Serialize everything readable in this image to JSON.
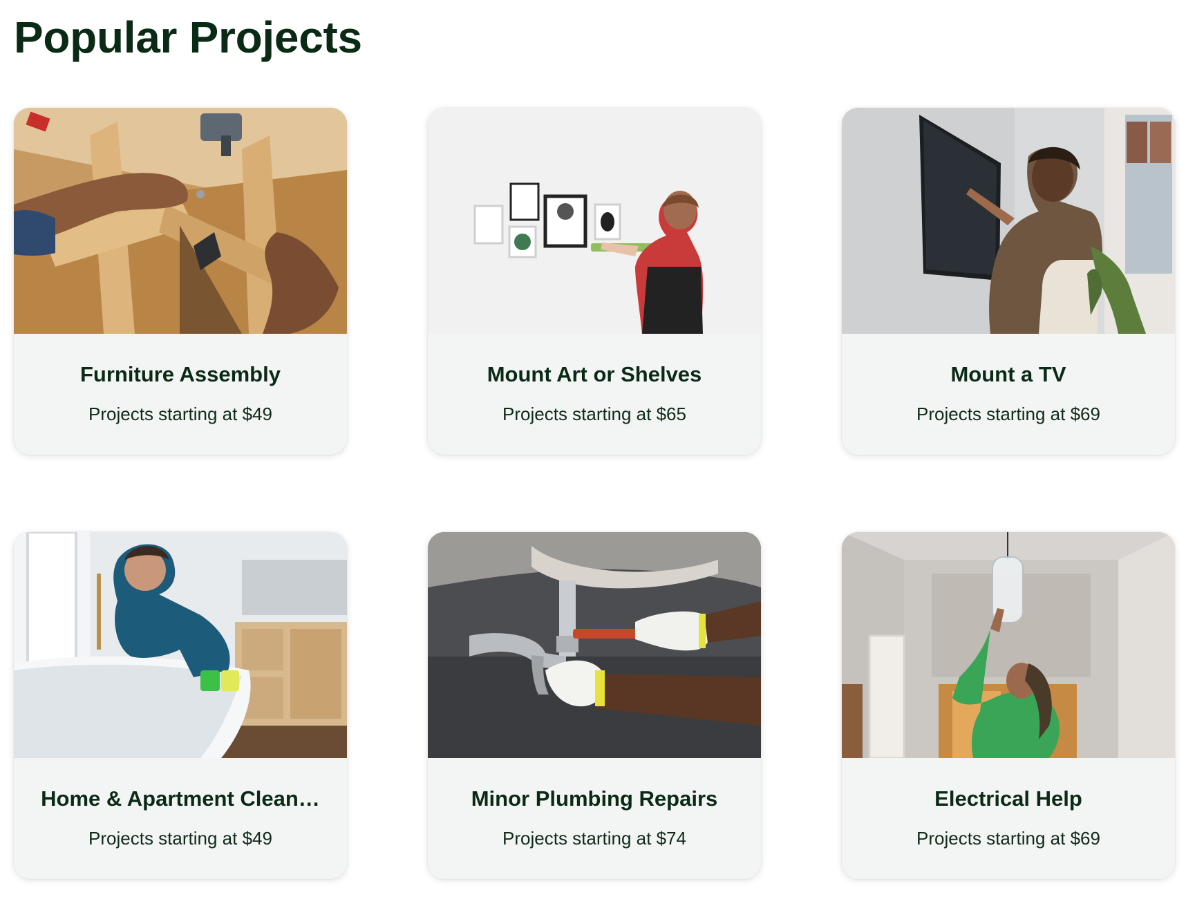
{
  "page": {
    "title": "Popular Projects"
  },
  "projects": [
    {
      "title": "Furniture Assembly",
      "price": "Projects starting at $49",
      "image_subject": "hands assembling wooden furniture"
    },
    {
      "title": "Mount Art or Shelves",
      "price": "Projects starting at $65",
      "image_subject": "person hanging picture frames with a level"
    },
    {
      "title": "Mount a TV",
      "price": "Projects starting at $69",
      "image_subject": "woman mounting a flat screen TV on a wall"
    },
    {
      "title": "Home & Apartment Clean…",
      "price": "Projects starting at $49",
      "image_subject": "woman cleaning a bathtub"
    },
    {
      "title": "Minor Plumbing Repairs",
      "price": "Projects starting at $74",
      "image_subject": "gloved hands fixing sink pipe with wrench"
    },
    {
      "title": "Electrical Help",
      "price": "Projects starting at $69",
      "image_subject": "woman installing a pendant light"
    }
  ],
  "colors": {
    "title": "#0b2a16",
    "card_body": "#f3f5f4",
    "page_bg": "#ffffff"
  }
}
